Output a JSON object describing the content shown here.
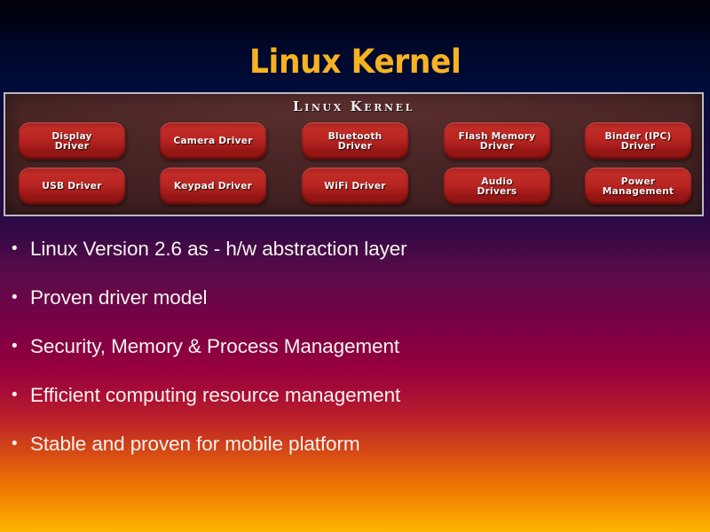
{
  "slide": {
    "title": "Linux Kernel",
    "title_color": "#f6b222",
    "background_colors": [
      "#000005",
      "#000c38",
      "#2d0a44",
      "#99003d",
      "#ef7a00",
      "#ffb400"
    ],
    "text_color": "#f6f2ee"
  },
  "diagram": {
    "heading": "Linux Kernel",
    "panel_border_color": "#b9b9c2",
    "panel_background_color": "#4a2525",
    "button_color": "#b82522",
    "drivers": [
      {
        "line1": "Display",
        "line2": "Driver",
        "name": "display-driver"
      },
      {
        "line1": "Camera Driver",
        "line2": "",
        "name": "camera-driver"
      },
      {
        "line1": "Bluetooth",
        "line2": "Driver",
        "name": "bluetooth-driver"
      },
      {
        "line1": "Flash Memory",
        "line2": "Driver",
        "name": "flash-memory-driver"
      },
      {
        "line1": "Binder (IPC)",
        "line2": "Driver",
        "name": "binder-ipc-driver"
      },
      {
        "line1": "USB Driver",
        "line2": "",
        "name": "usb-driver"
      },
      {
        "line1": "Keypad Driver",
        "line2": "",
        "name": "keypad-driver"
      },
      {
        "line1": "WiFi Driver",
        "line2": "",
        "name": "wifi-driver"
      },
      {
        "line1": "Audio",
        "line2": "Drivers",
        "name": "audio-drivers"
      },
      {
        "line1": "Power",
        "line2": "Management",
        "name": "power-management"
      }
    ]
  },
  "bullets": {
    "marker": "•",
    "items": [
      {
        "text": "Linux Version 2.6 as - h/w abstraction layer"
      },
      {
        "text": "Proven driver model"
      },
      {
        "text": "Security, Memory & Process Management"
      },
      {
        "text": "Efficient computing resource management"
      },
      {
        "text": "Stable and proven for mobile platform"
      }
    ]
  }
}
